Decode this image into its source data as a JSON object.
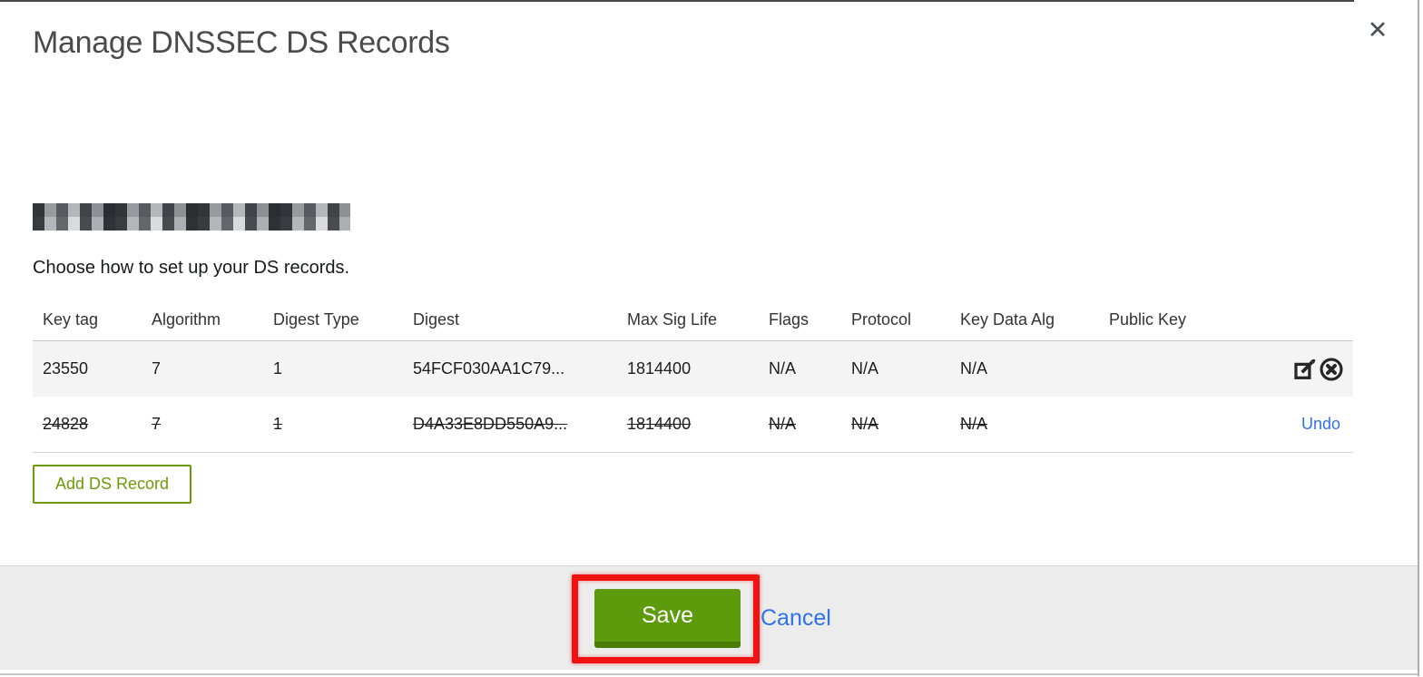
{
  "modal": {
    "title": "Manage DNSSEC DS Records",
    "close_icon_glyph": "✕",
    "instruction": "Choose how to set up your DS records.",
    "table": {
      "headers": [
        "Key tag",
        "Algorithm",
        "Digest Type",
        "Digest",
        "Max Sig Life",
        "Flags",
        "Protocol",
        "Key Data Alg",
        "Public Key"
      ],
      "rows": [
        {
          "key_tag": "23550",
          "algorithm": "7",
          "digest_type": "1",
          "digest": "54FCF030AA1C79...",
          "max_sig_life": "1814400",
          "flags": "N/A",
          "protocol": "N/A",
          "key_data_alg": "N/A",
          "public_key": "",
          "state": "active"
        },
        {
          "key_tag": "24828",
          "algorithm": "7",
          "digest_type": "1",
          "digest": "D4A33E8DD550A9...",
          "max_sig_life": "1814400",
          "flags": "N/A",
          "protocol": "N/A",
          "key_data_alg": "N/A",
          "public_key": "",
          "state": "deleted",
          "action_label": "Undo"
        }
      ]
    },
    "add_ds_record_label": "Add DS Record",
    "footer": {
      "save_label": "Save",
      "cancel_label": "Cancel"
    }
  },
  "colors": {
    "accent_green": "#5d9b0c",
    "outline_green": "#6b9a07",
    "link_blue": "#2e73e8",
    "annotation_red": "#ee1212",
    "row_highlight": "#f4f4f4",
    "footer_bg": "#ececec"
  }
}
